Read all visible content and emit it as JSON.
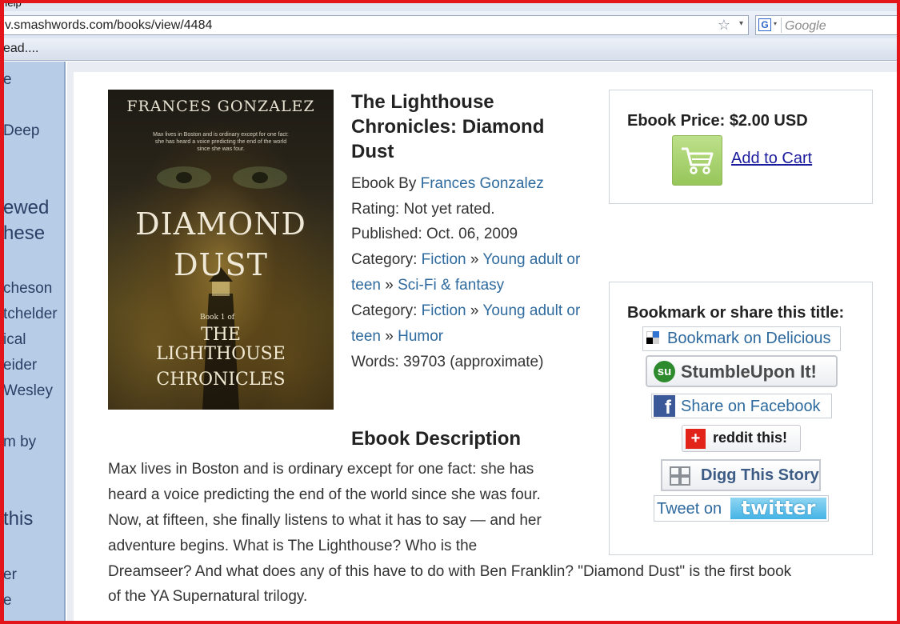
{
  "browser": {
    "menu_help": "Help",
    "url": "v.smashwords.com/books/view/4484",
    "search_placeholder": "Google",
    "tab_title": "ead...."
  },
  "left_sidebar_fragments": [
    "e",
    "Deep",
    "ewed",
    "hese",
    "cheson",
    "tchelder",
    "ical",
    "eider",
    "Wesley",
    "m by",
    "this",
    "er",
    "e"
  ],
  "cover": {
    "author": "FRANCES GONZALEZ",
    "blurb": "Max lives in Boston and is ordinary except for one fact: she has heard a voice predicting the end of the world since she was four.",
    "title_line1": "DIAMOND",
    "title_line2": "DUST",
    "book_label": "Book 1 of",
    "series_line1": "THE",
    "series_line2": "LIGHTHOUSE",
    "series_line3": "CHRONICLES"
  },
  "book": {
    "title": "The Lighthouse Chronicles: Diamond Dust",
    "ebook_by_label": "Ebook By",
    "author": "Frances Gonzalez",
    "rating": "Rating: Not yet rated.",
    "published": "Published: Oct. 06, 2009",
    "category_label": "Category:",
    "categories": [
      {
        "c1": "Fiction",
        "c2": "Young adult or",
        "c2b": "teen",
        "c3": "Sci-Fi & fantasy"
      },
      {
        "c1": "Fiction",
        "c2": "Young adult or",
        "c2b": "teen",
        "c3": "Humor"
      }
    ],
    "sep": "»",
    "words": "Words: 39703 (approximate)"
  },
  "purchase": {
    "price_label": "Ebook Price: $2.00 USD",
    "add_to_cart": "Add to Cart"
  },
  "share": {
    "title": "Bookmark or share this title:",
    "delicious": "Bookmark on Delicious",
    "stumble": "StumbleUpon It!",
    "facebook": "Share on Facebook",
    "reddit": "reddit this!",
    "digg": "Digg This Story",
    "tweet_on": "Tweet on",
    "twitter": "twitter"
  },
  "description": {
    "heading": "Ebook Description",
    "lines": [
      "Max lives in Boston and is ordinary except for one fact: she has",
      "heard a voice predicting the end of the world since she was four.",
      "Now, at fifteen, she finally listens to what it has to say — and her",
      "adventure begins. What is The Lighthouse? Who is the",
      "Dreamseer? And what does any of this have to do with Ben Franklin? \"Diamond Dust\" is the first book",
      "of the YA Supernatural trilogy."
    ]
  }
}
